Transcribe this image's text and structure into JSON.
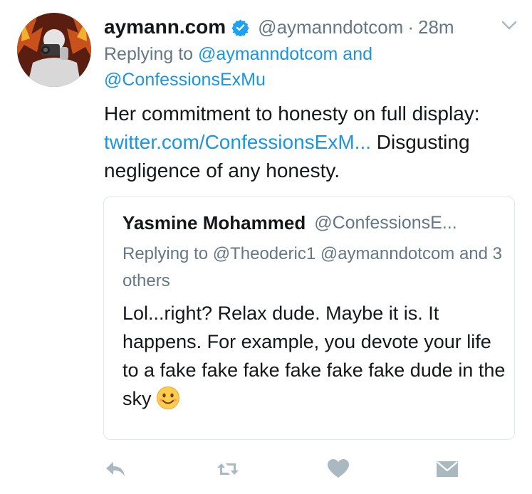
{
  "tweet": {
    "display_name": "aymann.com",
    "handle": "@aymanndotcom",
    "separator": "·",
    "time": "28m",
    "replying_prefix": "Replying to",
    "replying_user_1": "@aymanndotcom",
    "replying_and": "and",
    "replying_user_2": "@ConfessionsExMu",
    "text_part1": "Her commitment to honesty on full display:",
    "link": "twitter.com/ConfessionsExM...",
    "text_part2": "Disgusting negligence of any honesty."
  },
  "quote": {
    "display_name": "Yasmine Mohammed",
    "handle": "@ConfessionsE...",
    "replying": "Replying to @Theoderic1 @aymanndotcom and 3 others",
    "text": "Lol...right? Relax dude. Maybe it is. It happens. For example, you devote your life to a fake fake fake fake fake fake dude in the sky"
  },
  "icons": {
    "verified": "verified-badge-icon",
    "menu": "chevron-down-icon",
    "reply": "reply-icon",
    "retweet": "retweet-icon",
    "like": "heart-icon",
    "dm": "envelope-icon",
    "emoji": "smiling-face-emoji"
  },
  "colors": {
    "link": "#1b95e0",
    "secondary_text": "#657786",
    "action_icon": "#aab8c2",
    "border": "#e1e8ed"
  }
}
